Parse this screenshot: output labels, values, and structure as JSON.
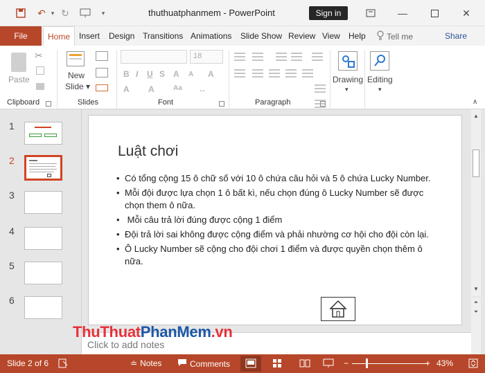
{
  "titlebar": {
    "doc_name": "thuthuatphanmem",
    "separator": "-",
    "app_name": "PowerPoint",
    "sign_in": "Sign in"
  },
  "tabs": [
    "File",
    "Home",
    "Insert",
    "Design",
    "Transitions",
    "Animations",
    "Slide Show",
    "Review",
    "View",
    "Help"
  ],
  "tell_me": "Tell me",
  "share": "Share",
  "ribbon": {
    "clipboard": {
      "label": "Clipboard",
      "paste": "Paste"
    },
    "slides": {
      "label": "Slides",
      "new_slide_line1": "New",
      "new_slide_line2": "Slide"
    },
    "font": {
      "label": "Font",
      "font_size": "18"
    },
    "paragraph": {
      "label": "Paragraph"
    },
    "drawing": {
      "label": "Drawing"
    },
    "editing": {
      "label": "Editing"
    }
  },
  "thumbnails": [
    "1",
    "2",
    "3",
    "4",
    "5",
    "6"
  ],
  "active_slide": 2,
  "slide": {
    "title": "Luật chơi",
    "bullets": [
      "Có tổng cộng 15 ô chữ số với 10 ô chứa câu hỏi và 5 ô chứa Lucky Number.",
      "Mỗi đội được lựa chọn 1 ô bất kì, nếu chọn đúng ô Lucky Number sẽ được chọn them ô nữa.",
      " Mỗi câu trả lời đúng được cộng 1 điểm",
      "Đội trả lời sai không được cộng điểm và phải nhường cơ hội cho đội còn lại.",
      "Ô Lucky Number sẽ cộng cho đội chơi 1 điểm và được quyền chọn thêm ô nữa."
    ]
  },
  "notes_placeholder": "Click to add notes",
  "watermark": {
    "part1": "ThuThuat",
    "part2": "PhanMem",
    "part3": ".vn"
  },
  "statusbar": {
    "slide_info": "Slide 2 of 6",
    "notes": "Notes",
    "comments": "Comments",
    "zoom": "43%"
  },
  "colors": {
    "accent": "#b7472a",
    "active_thumb": "#d04423"
  }
}
